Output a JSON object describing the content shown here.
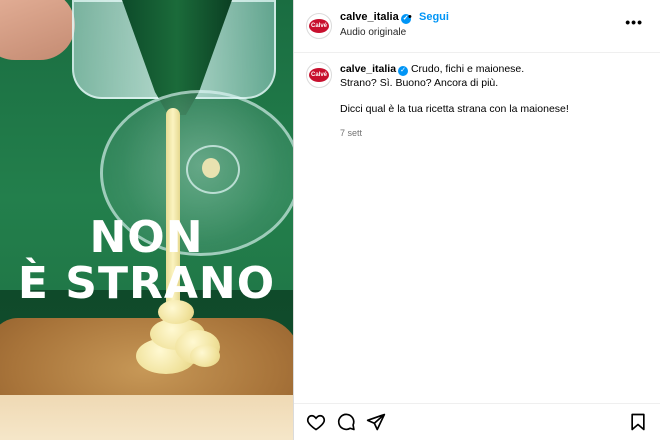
{
  "media": {
    "overlay_line1": "NON",
    "overlay_line2": "È STRANO"
  },
  "header": {
    "username": "calve_italia",
    "separator": "•",
    "follow_label": "Segui",
    "subtitle": "Audio originale",
    "more_icon": "more-horizontal-icon",
    "avatar_text": "Calvé"
  },
  "caption": {
    "username": "calve_italia",
    "line1": "Crudo, fichi e maionese.",
    "line2": "Strano? Sì. Buono? Ancora di più.",
    "line3": "Dicci qual è la tua ricetta strana con la maionese!",
    "timestamp": "7 sett"
  },
  "actions": {
    "like_icon": "heart-icon",
    "comment_icon": "comment-icon",
    "share_icon": "share-icon",
    "save_icon": "bookmark-icon"
  },
  "colors": {
    "link_blue": "#0095f6",
    "brand_red": "#c8102e",
    "muted_text": "#737373"
  }
}
